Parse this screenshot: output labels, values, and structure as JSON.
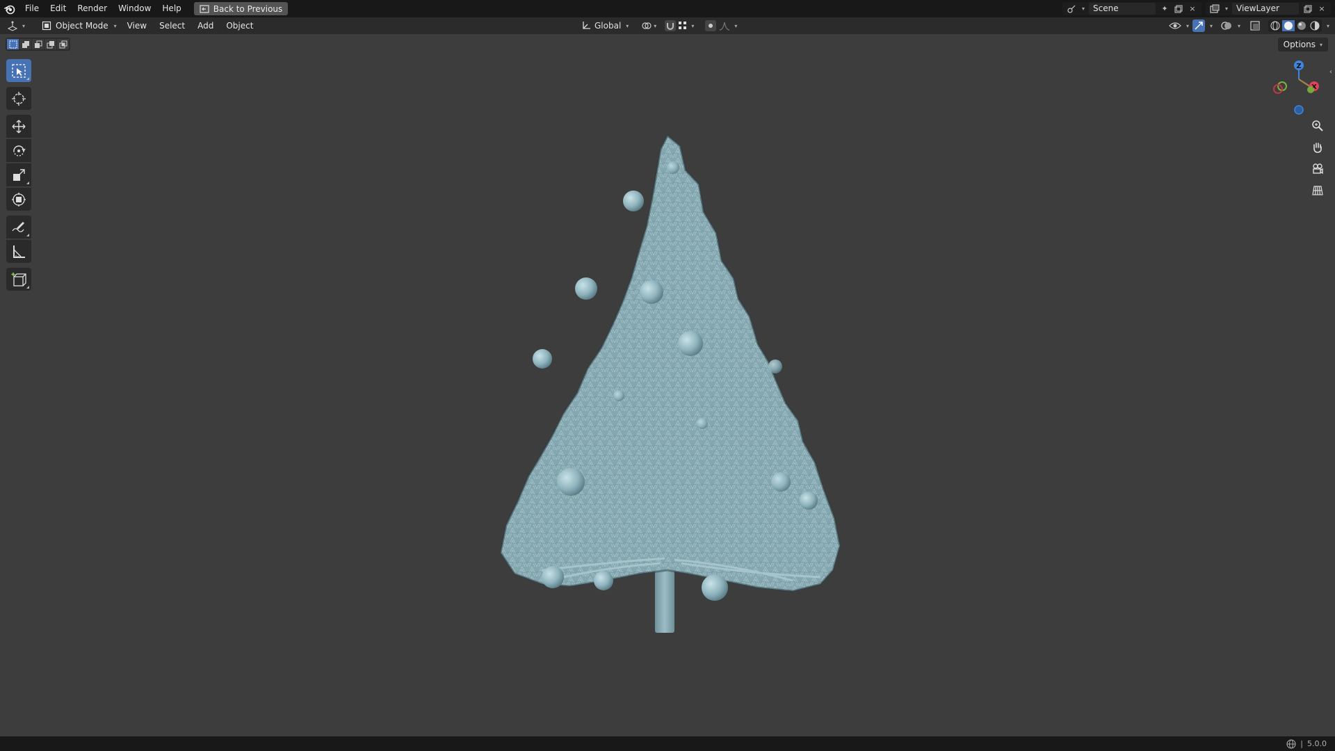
{
  "menu": {
    "file": "File",
    "edit": "Edit",
    "render": "Render",
    "window": "Window",
    "help": "Help",
    "back_to_previous": "Back to Previous"
  },
  "top_right": {
    "scene_label": "Scene",
    "view_layer_label": "ViewLayer"
  },
  "header": {
    "mode": "Object Mode",
    "view": "View",
    "select": "Select",
    "add": "Add",
    "object": "Object",
    "transform_orientation": "Global"
  },
  "viewport": {
    "options_label": "Options",
    "gizmo_axes": [
      "Z",
      "X",
      "Y"
    ]
  },
  "toolbar": {
    "tools": [
      "select-box",
      "cursor",
      "move",
      "rotate",
      "scale",
      "transform",
      "annotate",
      "measure",
      "add-cube"
    ],
    "active_tool": "select-box"
  },
  "status": {
    "version": "5.0.0"
  },
  "colors": {
    "accent": "#4772b3",
    "viewport_bg": "#3d3d3d",
    "tree_color": "#8fb3bd",
    "axis_x": "#e0435a",
    "axis_y": "#7ab43a",
    "axis_z": "#3b86e0"
  }
}
